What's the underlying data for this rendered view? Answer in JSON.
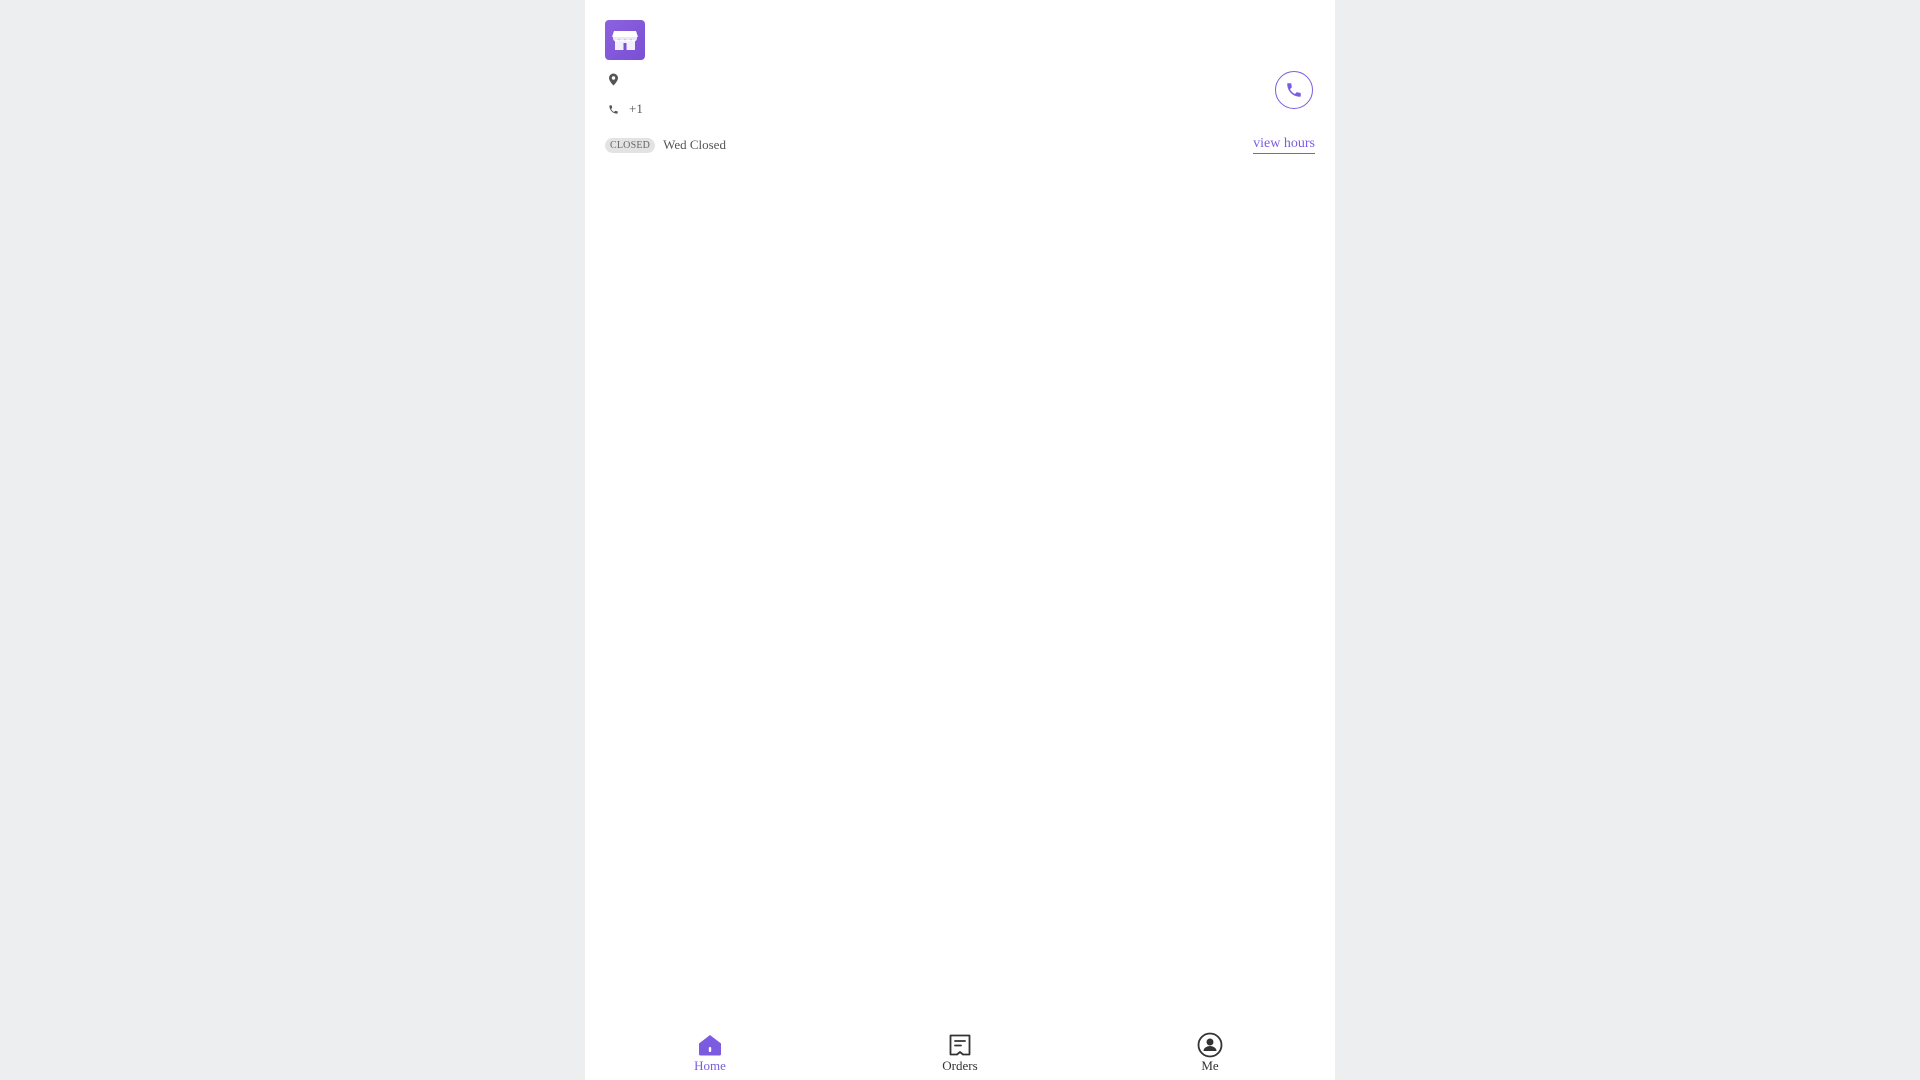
{
  "store": {
    "phone": "+1",
    "status_badge": "CLOSED",
    "status_text": "Wed Closed",
    "view_hours_label": "view hours"
  },
  "tabs": [
    {
      "label": "Home",
      "icon": "home-icon",
      "active": true
    },
    {
      "label": "Orders",
      "icon": "receipt-icon",
      "active": false
    },
    {
      "label": "Me",
      "icon": "user-circle-icon",
      "active": false
    }
  ],
  "colors": {
    "accent": "#7b5ce0",
    "page_background": "#edeef0",
    "badge_background": "#e3e3e3",
    "text": "#555555"
  }
}
